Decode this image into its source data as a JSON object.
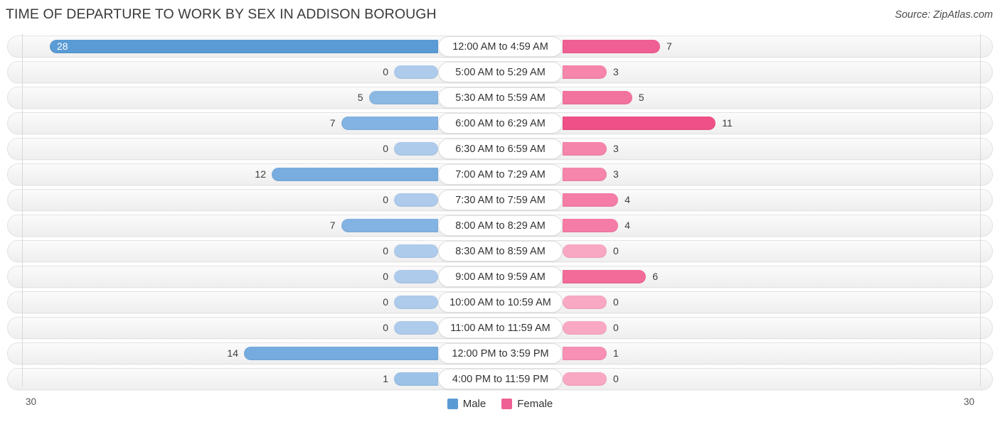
{
  "header": {
    "title": "TIME OF DEPARTURE TO WORK BY SEX IN ADDISON BOROUGH",
    "source": "Source: ZipAtlas.com"
  },
  "footer": {
    "axis_min_label": "30",
    "axis_max_label": "30",
    "legend": [
      {
        "label": "Male",
        "color": "#5b9bd5"
      },
      {
        "label": "Female",
        "color": "#ef5f93"
      }
    ]
  },
  "chart_data": {
    "type": "bar",
    "subtype": "diverging-bidirectional",
    "title": "TIME OF DEPARTURE TO WORK BY SEX IN ADDISON BOROUGH",
    "source": "Source: ZipAtlas.com",
    "xlabel": "",
    "ylabel": "",
    "axis_max": 30,
    "axis_min": 30,
    "xlim": [
      30,
      30
    ],
    "grid": false,
    "legend_position": "bottom-center",
    "categories": [
      "12:00 AM to 4:59 AM",
      "5:00 AM to 5:29 AM",
      "5:30 AM to 5:59 AM",
      "6:00 AM to 6:29 AM",
      "6:30 AM to 6:59 AM",
      "7:00 AM to 7:29 AM",
      "7:30 AM to 7:59 AM",
      "8:00 AM to 8:29 AM",
      "8:30 AM to 8:59 AM",
      "9:00 AM to 9:59 AM",
      "10:00 AM to 10:59 AM",
      "11:00 AM to 11:59 AM",
      "12:00 PM to 3:59 PM",
      "4:00 PM to 11:59 PM"
    ],
    "series": [
      {
        "name": "Male",
        "color": "#5b9bd5",
        "values": [
          28,
          0,
          5,
          7,
          0,
          12,
          0,
          7,
          0,
          0,
          0,
          0,
          14,
          1
        ]
      },
      {
        "name": "Female",
        "color": "#ef5f93",
        "values": [
          7,
          3,
          5,
          11,
          3,
          3,
          4,
          4,
          0,
          6,
          0,
          0,
          1,
          0
        ]
      }
    ],
    "rows": [
      {
        "category": "12:00 AM to 4:59 AM",
        "male": 28,
        "female": 7,
        "male_color": "#5b9bd5",
        "female_color": "#ef5f93",
        "male_label": "28",
        "female_label": "7",
        "male_label_inside": true
      },
      {
        "category": "5:00 AM to 5:29 AM",
        "male": 0,
        "female": 3,
        "male_color": "#aecbec",
        "female_color": "#f685ac",
        "male_label": "0",
        "female_label": "3",
        "male_label_inside": false
      },
      {
        "category": "5:30 AM to 5:59 AM",
        "male": 5,
        "female": 5,
        "male_color": "#8cb8e4",
        "female_color": "#f3739f",
        "male_label": "5",
        "female_label": "5",
        "male_label_inside": false
      },
      {
        "category": "6:00 AM to 6:29 AM",
        "male": 7,
        "female": 11,
        "male_color": "#83b3e2",
        "female_color": "#ef5088",
        "male_label": "7",
        "female_label": "11",
        "male_label_inside": false
      },
      {
        "category": "6:30 AM to 6:59 AM",
        "male": 0,
        "female": 3,
        "male_color": "#aecbec",
        "female_color": "#f685ac",
        "male_label": "0",
        "female_label": "3",
        "male_label_inside": false
      },
      {
        "category": "7:00 AM to 7:29 AM",
        "male": 12,
        "female": 3,
        "male_color": "#79ade0",
        "female_color": "#f685ac",
        "male_label": "12",
        "female_label": "3",
        "male_label_inside": false
      },
      {
        "category": "7:30 AM to 7:59 AM",
        "male": 0,
        "female": 4,
        "male_color": "#aecbec",
        "female_color": "#f57ca6",
        "male_label": "0",
        "female_label": "4",
        "male_label_inside": false
      },
      {
        "category": "8:00 AM to 8:29 AM",
        "male": 7,
        "female": 4,
        "male_color": "#83b3e2",
        "female_color": "#f57ca6",
        "male_label": "7",
        "female_label": "4",
        "male_label_inside": false
      },
      {
        "category": "8:30 AM to 8:59 AM",
        "male": 0,
        "female": 0,
        "male_color": "#aecbec",
        "female_color": "#f9a8c4",
        "male_label": "0",
        "female_label": "0",
        "male_label_inside": false
      },
      {
        "category": "9:00 AM to 9:59 AM",
        "male": 0,
        "female": 6,
        "male_color": "#aecbec",
        "female_color": "#f26b99",
        "male_label": "0",
        "female_label": "6",
        "male_label_inside": false
      },
      {
        "category": "10:00 AM to 10:59 AM",
        "male": 0,
        "female": 0,
        "male_color": "#aecbec",
        "female_color": "#f9a8c4",
        "male_label": "0",
        "female_label": "0",
        "male_label_inside": false
      },
      {
        "category": "11:00 AM to 11:59 AM",
        "male": 0,
        "female": 0,
        "male_color": "#aecbec",
        "female_color": "#f9a8c4",
        "male_label": "0",
        "female_label": "0",
        "male_label_inside": false
      },
      {
        "category": "12:00 PM to 3:59 PM",
        "male": 14,
        "female": 1,
        "male_color": "#76abdf",
        "female_color": "#f790b4",
        "male_label": "14",
        "female_label": "1",
        "male_label_inside": false
      },
      {
        "category": "4:00 PM to 11:59 PM",
        "male": 1,
        "female": 0,
        "male_color": "#9cc2e8",
        "female_color": "#f9a8c4",
        "male_label": "1",
        "female_label": "0",
        "male_label_inside": false
      }
    ]
  }
}
